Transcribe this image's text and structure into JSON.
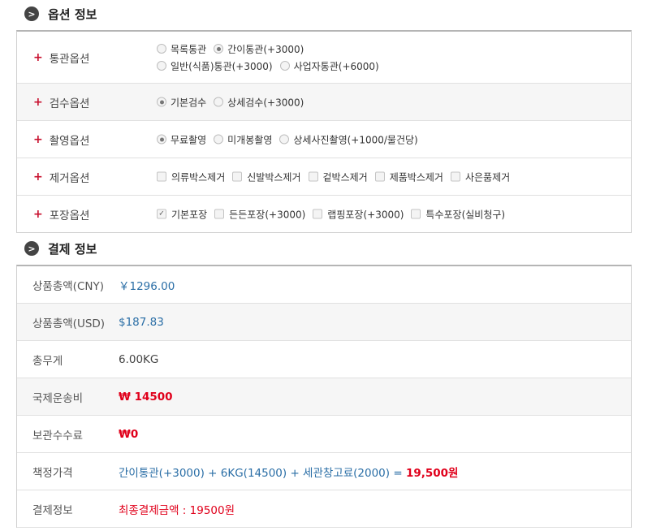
{
  "options_section": {
    "title": "옵션 정보",
    "rows": [
      {
        "label": "통관옵션",
        "choices": [
          {
            "label": "목록통관",
            "selected": false
          },
          {
            "label": "간이통관(+3000)",
            "selected": true
          },
          {
            "label": "일반(식품)통관(+3000)",
            "selected": false
          },
          {
            "label": "사업자통관(+6000)",
            "selected": false
          }
        ]
      },
      {
        "label": "검수옵션",
        "choices": [
          {
            "label": "기본검수",
            "selected": true
          },
          {
            "label": "상세검수(+3000)",
            "selected": false
          }
        ]
      },
      {
        "label": "촬영옵션",
        "choices": [
          {
            "label": "무료촬영",
            "selected": true
          },
          {
            "label": "미개봉촬영",
            "selected": false
          },
          {
            "label": "상세사진촬영(+1000/물건당)",
            "selected": false
          }
        ]
      },
      {
        "label": "제거옵션",
        "choices": [
          {
            "label": "의류박스제거",
            "checked": false
          },
          {
            "label": "신발박스제거",
            "checked": false
          },
          {
            "label": "겉박스제거",
            "checked": false
          },
          {
            "label": "제품박스제거",
            "checked": false
          },
          {
            "label": "사은품제거",
            "checked": false
          }
        ]
      },
      {
        "label": "포장옵션",
        "choices": [
          {
            "label": "기본포장",
            "checked": true
          },
          {
            "label": "든든포장(+3000)",
            "checked": false
          },
          {
            "label": "랩핑포장(+3000)",
            "checked": false
          },
          {
            "label": "특수포장(실비청구)",
            "checked": false
          }
        ]
      }
    ]
  },
  "payment_section": {
    "title": "결제 정보",
    "rows": {
      "total_cny": {
        "label": "상품총액(CNY)",
        "value": "￥1296.00"
      },
      "total_usd": {
        "label": "상품총액(USD)",
        "value": "$187.83"
      },
      "weight": {
        "label": "총무게",
        "value": "6.00KG"
      },
      "shipping": {
        "label": "국제운송비",
        "value": "₩ 14500"
      },
      "storage": {
        "label": "보관수수료",
        "value": "₩0"
      },
      "pricing": {
        "label": "책정가격",
        "formula": "간이통관(+3000) + 6KG(14500) + 세관창고료(2000) =",
        "total": "19,500원"
      },
      "payment": {
        "label": "결제정보",
        "value": "최종결제금액 : 19500원"
      }
    }
  },
  "colors": {
    "accent_red": "#e0001b",
    "link_blue": "#2a6ea6",
    "plus_red": "#c8102e"
  },
  "icons": {
    "section_marker": "chevron-right-circle-icon",
    "option_marker": "plus-icon",
    "checkmark": "check-icon"
  }
}
